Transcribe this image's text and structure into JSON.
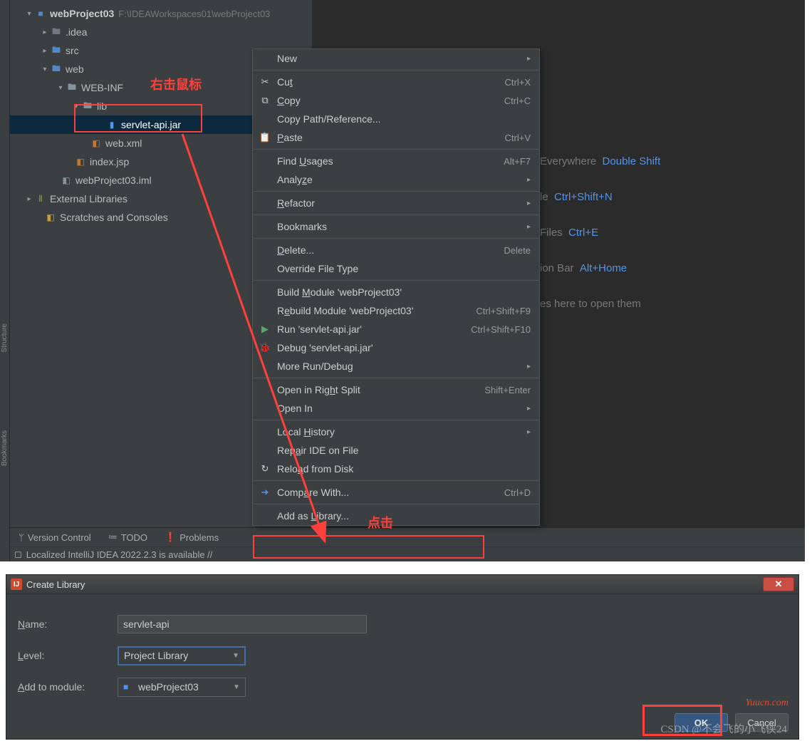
{
  "project": {
    "name": "webProject03",
    "path": "F:\\IDEAWorkspaces01\\webProject03",
    "tree": {
      "idea": ".idea",
      "src": "src",
      "web": "web",
      "webinf": "WEB-INF",
      "lib": "lib",
      "jar": "servlet-api.jar",
      "webxml": "web.xml",
      "indexjsp": "index.jsp",
      "iml": "webProject03.iml",
      "extlib": "External Libraries",
      "scratches": "Scratches and Consoles"
    }
  },
  "annotations": {
    "rightclick": "右击鼠标",
    "click": "点击"
  },
  "context_menu": [
    {
      "label": "New",
      "arrow": true
    },
    {
      "sep": true
    },
    {
      "icon": "✂",
      "label": "Cut",
      "mn": "t",
      "shortcut": "Ctrl+X"
    },
    {
      "icon": "⧉",
      "label": "Copy",
      "mn": "C",
      "shortcut": "Ctrl+C"
    },
    {
      "label": "Copy Path/Reference..."
    },
    {
      "icon": "📋",
      "label": "Paste",
      "mn": "P",
      "shortcut": "Ctrl+V"
    },
    {
      "sep": true
    },
    {
      "label": "Find Usages",
      "mn": "U",
      "shortcut": "Alt+F7"
    },
    {
      "label": "Analyze",
      "mn": "z",
      "arrow": true
    },
    {
      "sep": true
    },
    {
      "label": "Refactor",
      "mn": "R",
      "arrow": true
    },
    {
      "sep": true
    },
    {
      "label": "Bookmarks",
      "arrow": true
    },
    {
      "sep": true
    },
    {
      "label": "Delete...",
      "mn": "D",
      "shortcut": "Delete"
    },
    {
      "label": "Override File Type"
    },
    {
      "sep": true
    },
    {
      "label": "Build Module 'webProject03'",
      "mn": "M"
    },
    {
      "label": "Rebuild Module 'webProject03'",
      "mn": "E",
      "shortcut": "Ctrl+Shift+F9"
    },
    {
      "icon": "▶",
      "iconColor": "#59a869",
      "label": "Run 'servlet-api.jar'",
      "shortcut": "Ctrl+Shift+F10"
    },
    {
      "icon": "🐞",
      "iconColor": "#59a869",
      "label": "Debug 'servlet-api.jar'"
    },
    {
      "label": "More Run/Debug",
      "arrow": true
    },
    {
      "sep": true
    },
    {
      "label": "Open in Right Split",
      "mn": "h",
      "shortcut": "Shift+Enter"
    },
    {
      "label": "Open In",
      "arrow": true
    },
    {
      "sep": true
    },
    {
      "label": "Local History",
      "mn": "H",
      "arrow": true
    },
    {
      "label": "Repair IDE on File",
      "mn": "a"
    },
    {
      "icon": "↻",
      "label": "Reload from Disk",
      "mn": "a"
    },
    {
      "sep": true
    },
    {
      "icon": "➜",
      "iconColor": "#5394ec",
      "label": "Compare With...",
      "mn": "a",
      "shortcut": "Ctrl+D"
    },
    {
      "sep": true
    },
    {
      "label": "Add as Library...",
      "mn": "L"
    }
  ],
  "hints": {
    "h1a": "Everywhere",
    "h1b": "Double Shift",
    "h2a": "le",
    "h2b": "Ctrl+Shift+N",
    "h3a": "Files",
    "h3b": "Ctrl+E",
    "h4a": "ion Bar",
    "h4b": "Alt+Home",
    "h5": "es here to open them"
  },
  "status": {
    "version_control": "Version Control",
    "todo": "TODO",
    "problems": "Problems",
    "message": "Localized IntelliJ IDEA 2022.2.3 is available // "
  },
  "dialog": {
    "title": "Create Library",
    "name_label": "Name:",
    "name_value": "servlet-api",
    "level_label": "Level:",
    "level_value": "Project Library",
    "module_label": "Add to module:",
    "module_value": "webProject03",
    "ok": "OK",
    "cancel": "Cancel"
  },
  "watermark": {
    "yuucn": "Yuucn.com",
    "csdn": "CSDN @不会飞的小飞侠24"
  },
  "sidebar": {
    "structure": "Structure",
    "bookmarks": "Bookmarks"
  }
}
